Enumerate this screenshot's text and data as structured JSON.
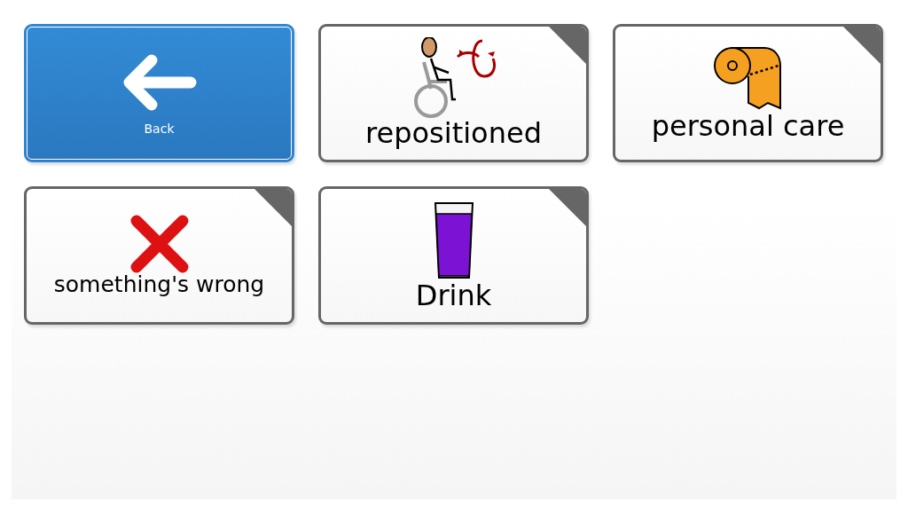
{
  "tiles": [
    {
      "kind": "back",
      "label": "Back"
    },
    {
      "kind": "folder",
      "label": "repositioned"
    },
    {
      "kind": "folder",
      "label": "personal care"
    },
    {
      "kind": "folder",
      "label": "something's wrong"
    },
    {
      "kind": "folder",
      "label": "Drink"
    }
  ]
}
